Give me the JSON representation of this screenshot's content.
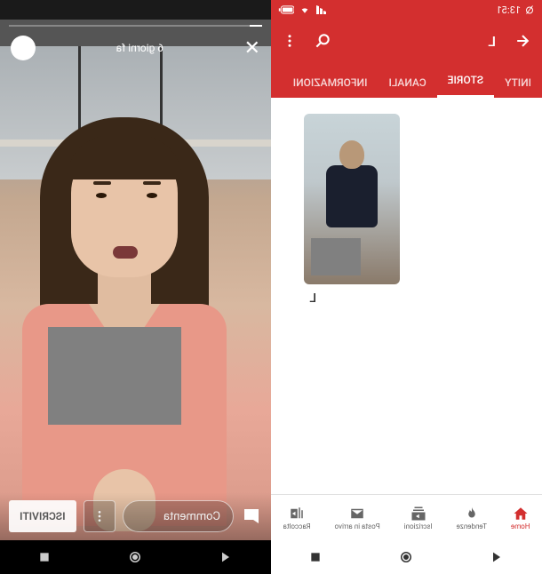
{
  "status": {
    "time": "13:51"
  },
  "toolbar": {
    "channel_initial": "L"
  },
  "tabs": {
    "items": [
      {
        "label": "INITY"
      },
      {
        "label": "STORIE"
      },
      {
        "label": "CANALI"
      },
      {
        "label": "INFORMAZIONI"
      }
    ],
    "active_index": 1
  },
  "story_thumb": {
    "caption": "L"
  },
  "bottom_nav": {
    "items": [
      {
        "label": "Home",
        "active": true
      },
      {
        "label": "Tendenze",
        "active": false
      },
      {
        "label": "Iscrizioni",
        "active": false
      },
      {
        "label": "Posta in arrivo",
        "active": false
      },
      {
        "label": "Raccolta",
        "active": false
      }
    ]
  },
  "story_viewer": {
    "timestamp": "6 giorni fa",
    "comment_placeholder": "Commenta",
    "subscribe_label": "ISCRIVITI"
  }
}
